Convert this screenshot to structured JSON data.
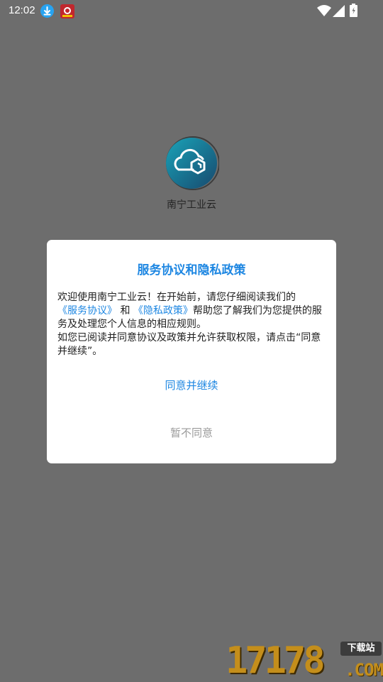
{
  "status_bar": {
    "time": "12:02",
    "icons": [
      "download-notification-icon",
      "app-notification-icon",
      "wifi-icon",
      "signal-icon",
      "battery-charging-icon"
    ]
  },
  "splash": {
    "app_name": "南宁工业云",
    "logo_icon": "cloud-logo-icon"
  },
  "dialog": {
    "title": "服务协议和隐私政策",
    "body": {
      "line1": "欢迎使用南宁工业云！在开始前，请您仔细阅读我们的",
      "service_link": "《服务协议》",
      "and": "和",
      "privacy_link": "《隐私政策》",
      "after_links": "帮助您了解我们为您提供的服务及处理您个人信息的相应规则。",
      "line2": "如您已阅读并同意协议及政策并允许获取权限，请点击“同意并继续”。"
    },
    "agree_label": "同意并继续",
    "disagree_label": "暂不同意"
  },
  "watermark": {
    "digits": "17178",
    "badge": "下载站",
    "suffix": ".COM"
  },
  "colors": {
    "overlay": "#6d6d6d",
    "accent": "#1e87e2",
    "muted": "#9a9a9a",
    "watermark": "#c48e1b"
  }
}
